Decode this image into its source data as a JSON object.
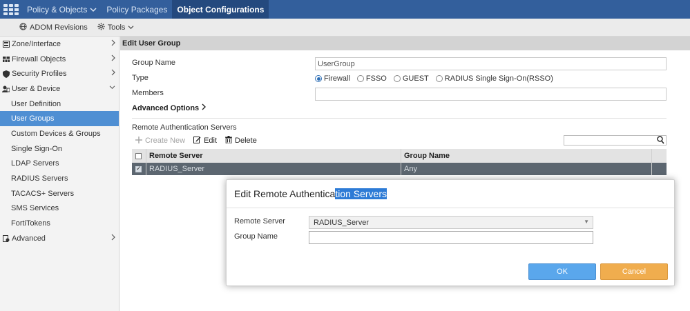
{
  "topnav": {
    "logo_icon": "fortinet-logo-icon",
    "items": [
      {
        "label": "Policy & Objects",
        "has_dropdown": true,
        "active": false
      },
      {
        "label": "Policy Packages",
        "has_dropdown": false,
        "active": false
      },
      {
        "label": "Object Configurations",
        "has_dropdown": false,
        "active": true
      }
    ],
    "colors": {
      "bar": "#335f9c",
      "active": "#24497e"
    }
  },
  "subbar": {
    "adom_revisions": "ADOM Revisions",
    "tools": "Tools"
  },
  "sidebar": {
    "items": [
      {
        "label": "Zone/Interface",
        "level": "top",
        "icon": "zone-icon",
        "chevron": "right"
      },
      {
        "label": "Firewall Objects",
        "level": "top",
        "icon": "firewall-icon",
        "chevron": "right"
      },
      {
        "label": "Security Profiles",
        "level": "top",
        "icon": "shield-icon",
        "chevron": "right"
      },
      {
        "label": "User & Device",
        "level": "top",
        "icon": "user-icon",
        "chevron": "down"
      },
      {
        "label": "User Definition",
        "level": "child"
      },
      {
        "label": "User Groups",
        "level": "child",
        "selected": true
      },
      {
        "label": "Custom Devices & Groups",
        "level": "child"
      },
      {
        "label": "Single Sign-On",
        "level": "child"
      },
      {
        "label": "LDAP Servers",
        "level": "child"
      },
      {
        "label": "RADIUS Servers",
        "level": "child"
      },
      {
        "label": "TACACS+ Servers",
        "level": "child"
      },
      {
        "label": "SMS Services",
        "level": "child"
      },
      {
        "label": "FortiTokens",
        "level": "child"
      },
      {
        "label": "Advanced",
        "level": "top",
        "icon": "advanced-icon",
        "chevron": "right"
      }
    ],
    "selected_color": "#4f8fd3"
  },
  "main": {
    "header": "Edit User Group",
    "group_name_label": "Group Name",
    "group_name_value": "UserGroup",
    "type_label": "Type",
    "type_options": [
      {
        "label": "Firewall",
        "checked": true
      },
      {
        "label": "FSSO",
        "checked": false
      },
      {
        "label": "GUEST",
        "checked": false
      },
      {
        "label": "RADIUS Single Sign-On(RSSO)",
        "checked": false
      }
    ],
    "members_label": "Members",
    "members_value": "",
    "advanced_options": "Advanced Options",
    "remote_auth_title": "Remote Authentication Servers",
    "toolbar": {
      "create_new": "Create New",
      "edit": "Edit",
      "delete": "Delete"
    },
    "table": {
      "headers": [
        "Remote Server",
        "Group Name"
      ],
      "rows": [
        {
          "remote_server": "RADIUS_Server",
          "group_name": "Any",
          "checked": true
        }
      ]
    }
  },
  "dialog": {
    "title_plain": "Edit Remote Authentica",
    "title_selected": "tion Servers",
    "remote_server_label": "Remote Server",
    "remote_server_value": "RADIUS_Server",
    "group_name_label": "Group Name",
    "group_name_value": "",
    "ok_label": "OK",
    "cancel_label": "Cancel",
    "colors": {
      "ok": "#5aa7ec",
      "cancel": "#f0ad4e",
      "selection": "#2d7bd6"
    }
  }
}
